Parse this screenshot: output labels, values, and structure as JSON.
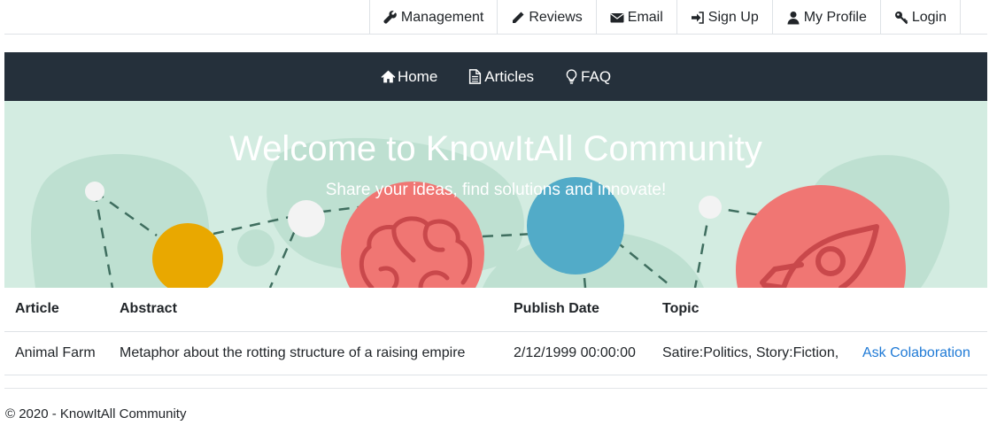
{
  "top_nav": {
    "items": [
      {
        "label": "Management",
        "icon": "wrench-icon"
      },
      {
        "label": "Reviews",
        "icon": "pencil-icon"
      },
      {
        "label": "Email",
        "icon": "envelope-icon"
      },
      {
        "label": "Sign Up",
        "icon": "sign-in-icon"
      },
      {
        "label": "My Profile",
        "icon": "user-icon"
      },
      {
        "label": "Login",
        "icon": "key-icon"
      }
    ]
  },
  "main_nav": {
    "items": [
      {
        "label": "Home",
        "icon": "home-icon"
      },
      {
        "label": "Articles",
        "icon": "file-text-icon"
      },
      {
        "label": "FAQ",
        "icon": "lightbulb-icon"
      }
    ]
  },
  "hero": {
    "title": "Welcome to KnowItAll Community",
    "subtitle": "Share your ideas, find solutions and innovate!"
  },
  "table": {
    "headers": [
      "Article",
      "Abstract",
      "Publish Date",
      "Topic",
      ""
    ],
    "rows": [
      {
        "article": "Animal Farm",
        "abstract": "Metaphor about the rotting structure of a raising empire",
        "publish_date": "2/12/1999 00:00:00",
        "topic": "Satire:Politics, Story:Fiction,",
        "action": "Ask Colaboration"
      }
    ]
  },
  "footer": {
    "text": "© 2020 - KnowItAll Community"
  },
  "colors": {
    "navbar_bg": "#25303b",
    "hero_bg": "#d3ece1",
    "link": "#1f7ad6",
    "coral": "#f07673",
    "yellow": "#e9a800",
    "blue": "#52abc8"
  }
}
